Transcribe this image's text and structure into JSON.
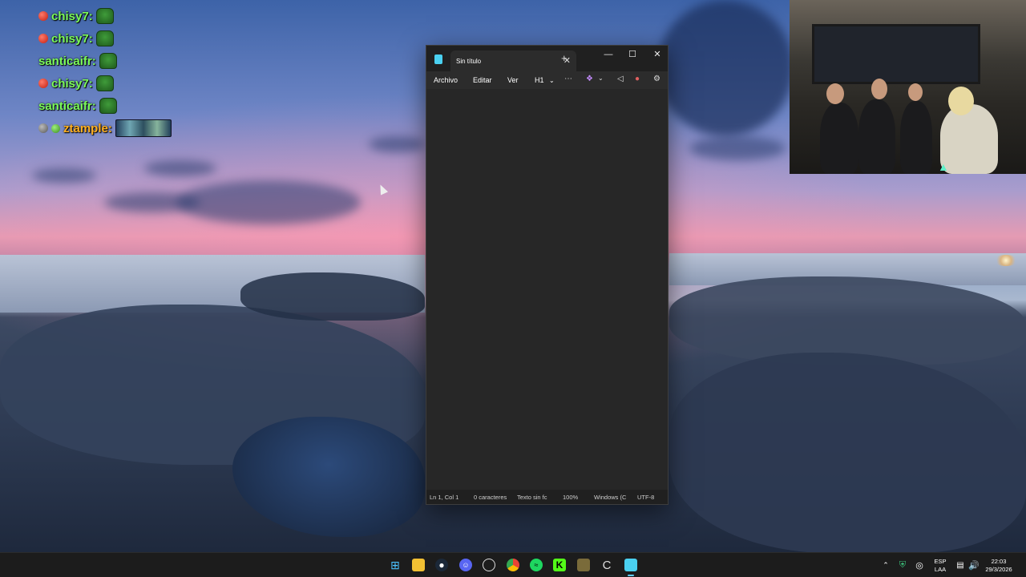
{
  "chat": [
    {
      "badge": "red",
      "user": "chisy7:",
      "emote": "pepe-emote"
    },
    {
      "badge": "red",
      "user": "chisy7:",
      "emote": "pepe-emote"
    },
    {
      "badge": "none",
      "user": "santicaifr:",
      "emote": "pepe-emote"
    },
    {
      "badge": "red",
      "user": "chisy7:",
      "emote": "pepe-emote"
    },
    {
      "badge": "none",
      "user": "santicaifr:",
      "emote": "pepe-emote"
    },
    {
      "badge": "gray",
      "user": "ztample:",
      "emote": "wide-emote"
    }
  ],
  "notepad": {
    "tab_title": "Sin título",
    "menu": {
      "file": "Archivo",
      "edit": "Editar",
      "view": "Ver",
      "heading": "H1"
    },
    "status": {
      "position": "Ln 1, Col 1",
      "chars": "0 caracteres",
      "format": "Texto sin fc",
      "zoom": "100%",
      "line_ending": "Windows (C",
      "encoding": "UTF-8"
    }
  },
  "taskbar": {
    "lang_top": "ESP",
    "lang_bottom": "LAA",
    "time": "22:03",
    "date": "29/3/2026"
  },
  "colors": {
    "chat_name": "#7cfc5a",
    "chat_name_special": "#ffb020",
    "accent": "#60cdff"
  }
}
